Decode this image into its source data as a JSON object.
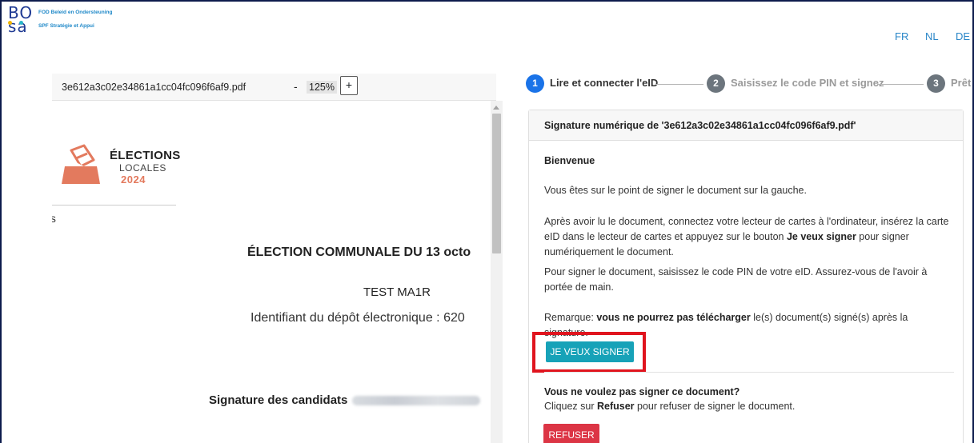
{
  "header": {
    "logo_mark_line1": "BO",
    "logo_mark_line2": "sa",
    "org_nl": "FOD Beleid en Ondersteuning",
    "org_fr": "SPF Stratégie et Appui",
    "languages": [
      "FR",
      "NL",
      "DE"
    ]
  },
  "pdf_viewer": {
    "filename": "3e612a3c02e34861a1cc04fc096f6af9.pdf",
    "zoom_minus": "-",
    "zoom_level": "125%",
    "zoom_plus": "+",
    "doc": {
      "logo_line1": "ÉLECTIONS",
      "logo_line2": "LOCALES",
      "logo_line3": "2024",
      "fragment": "ıs",
      "title": "ÉLECTION COMMUNALE DU 13 octo",
      "test": "TEST MA1R",
      "identifier": "Identifiant du dépôt électronique : 620",
      "signature_heading": "Signature des candidats"
    }
  },
  "steps": [
    {
      "number": "1",
      "label": "Lire et connecter l'eID"
    },
    {
      "number": "2",
      "label": "Saisissez le code PIN et signez"
    },
    {
      "number": "3",
      "label": "Prêt"
    }
  ],
  "card": {
    "title": "Signature numérique de '3e612a3c02e34861a1cc04fc096f6af9.pdf'",
    "welcome": "Bienvenue",
    "p1": "Vous êtes sur le point de signer le document sur la gauche.",
    "p2_before": "Après avoir lu le document, connectez votre lecteur de cartes à l'ordinateur, insérez la carte eID dans le lecteur de cartes et appuyez sur le bouton ",
    "p2_bold": "Je veux signer",
    "p2_after": " pour signer numériquement le document.",
    "p3": "Pour signer le document, saisissez le code PIN de votre eID. Assurez-vous de l'avoir à portée de main.",
    "note_label": "Remarque: ",
    "note_bold": "vous ne pourrez pas télécharger",
    "note_after": " le(s) document(s) signé(s) après la signature.",
    "sign_button": "JE VEUX SIGNER",
    "refuse_title": "Vous ne voulez pas signer ce document?",
    "refuse_before": "Cliquez sur ",
    "refuse_bold": "Refuser",
    "refuse_after": " pour refuser de signer le document.",
    "refuse_button": "REFUSER"
  },
  "colors": {
    "frame": "#0d1b4c",
    "step_active": "#1a73e8",
    "step_inactive": "#6c757d",
    "sign_button": "#17a2b8",
    "refuse_button": "#dc3545",
    "highlight": "#e0141e",
    "link": "#2a86c8"
  }
}
